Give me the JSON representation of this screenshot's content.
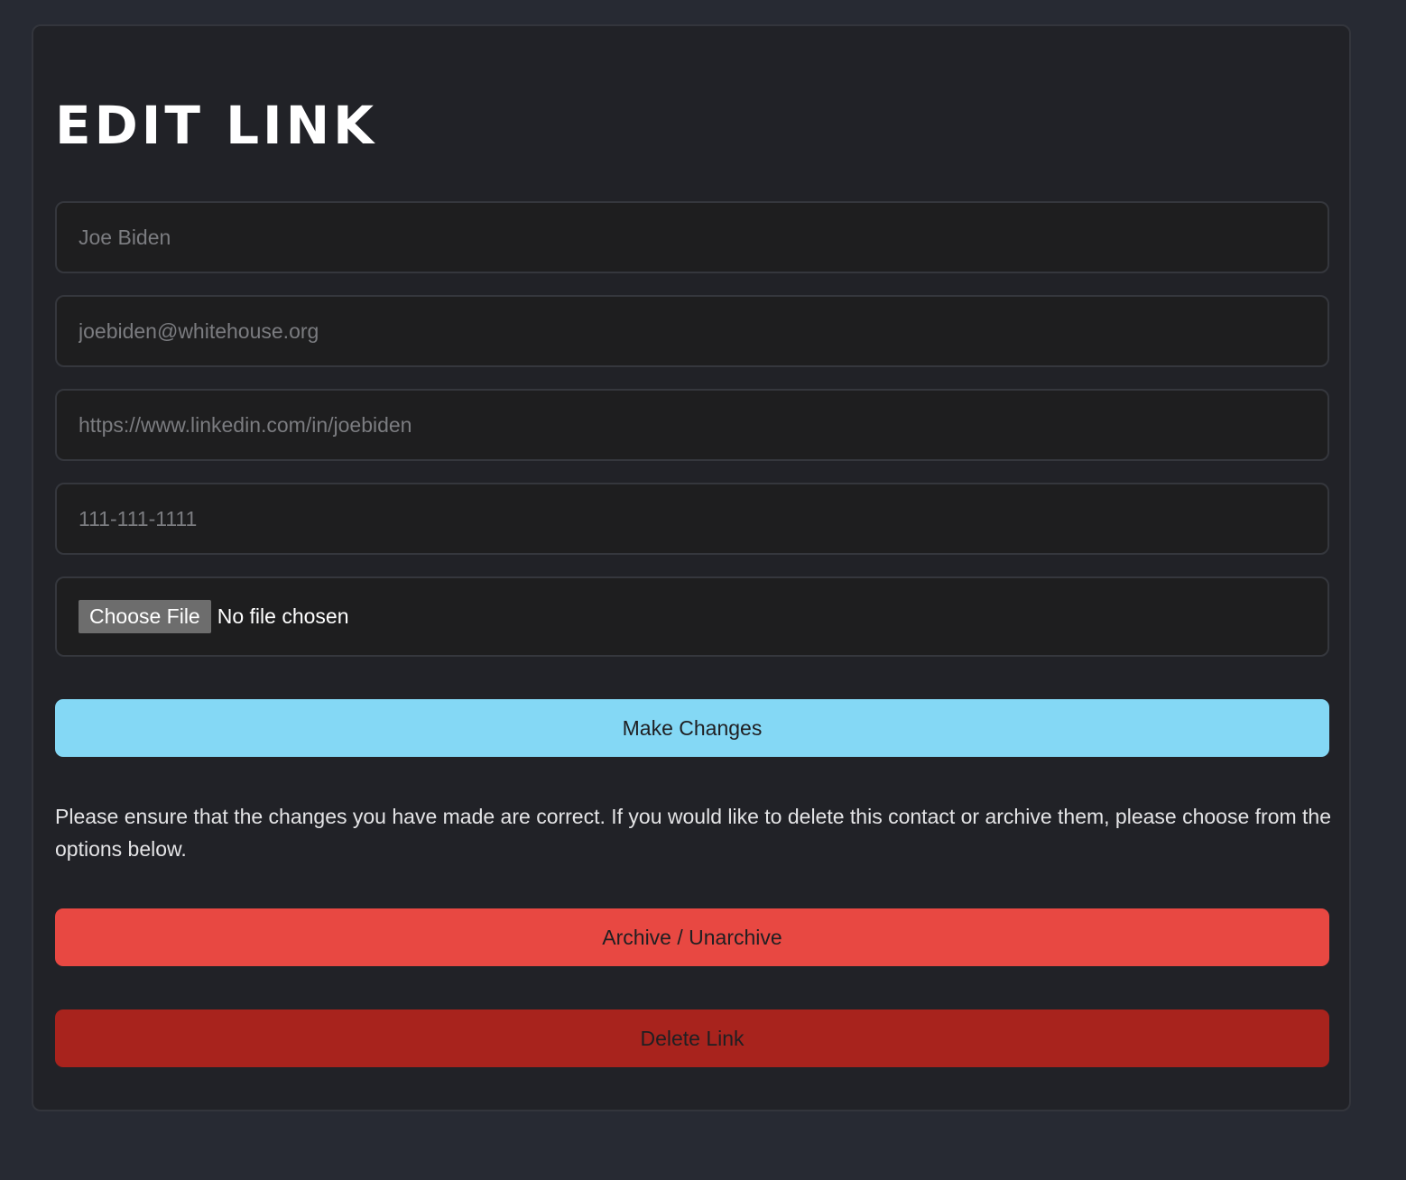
{
  "page": {
    "title": "EDIT LINK"
  },
  "form": {
    "name_placeholder": "Joe Biden",
    "email_placeholder": "joebiden@whitehouse.org",
    "linkedin_placeholder": "https://www.linkedin.com/in/joebiden",
    "phone_placeholder": "111-111-1111",
    "file_button_label": "Choose File",
    "file_status": "No file chosen"
  },
  "actions": {
    "make_changes_label": "Make Changes",
    "note": "Please ensure that the changes you have made are correct. If you would like to delete this contact or archive them, please choose from the options below.",
    "archive_label": "Archive / Unarchive",
    "delete_label": "Delete Link"
  },
  "colors": {
    "primary": "#84d8f5",
    "archive": "#e84842",
    "delete": "#a8231d"
  }
}
